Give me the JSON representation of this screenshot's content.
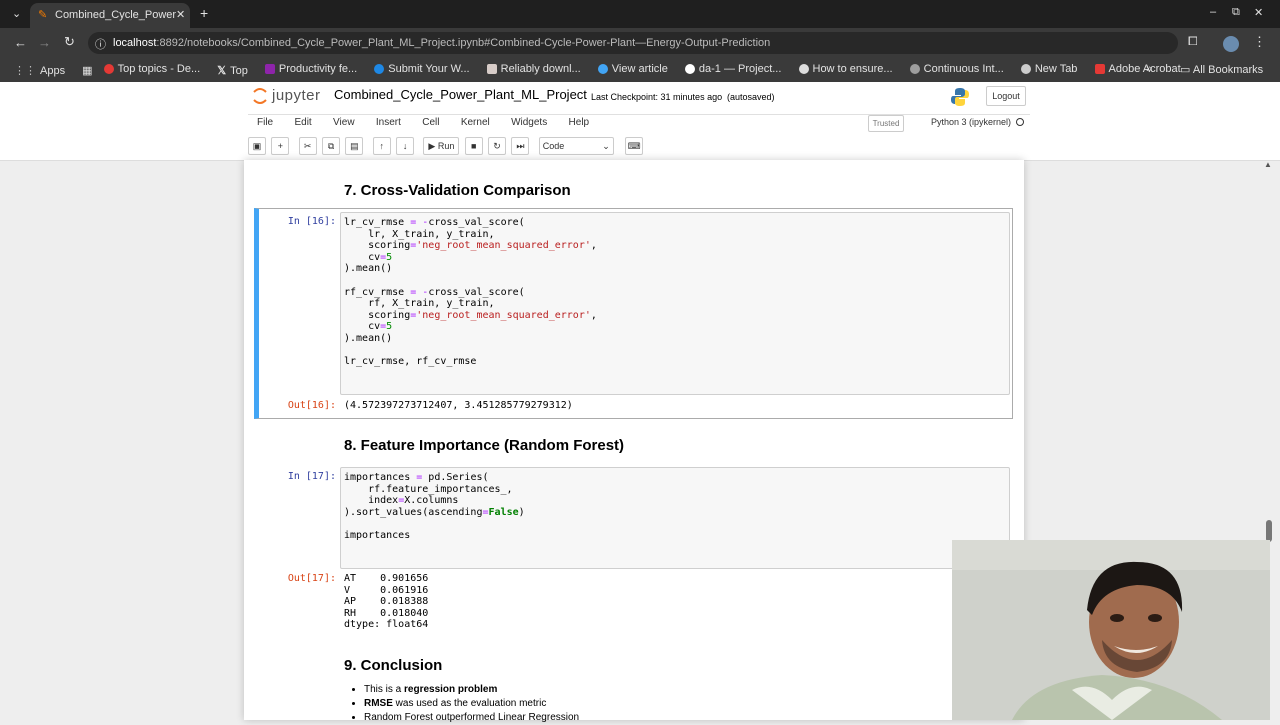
{
  "browser": {
    "tab_title": "Combined_Cycle_Power",
    "url_host": "localhost",
    "url_rest": ":8892/notebooks/Combined_Cycle_Power_Plant_ML_Project.ipynb#Combined-Cycle-Power-Plant—Energy-Output-Prediction",
    "bookmarks": [
      "Apps",
      "Top topics - De...",
      "Top",
      "Productivity fe...",
      "Submit Your W...",
      "Reliably downl...",
      "View article",
      "da-1 — Project...",
      "How to ensure...",
      "Continuous Int...",
      "New Tab",
      "Adobe Acrobat"
    ],
    "all_bookmarks": "All Bookmarks"
  },
  "jupyter": {
    "logo": "jupyter",
    "notebook_name": "Combined_Cycle_Power_Plant_ML_Project",
    "checkpoint": "Last Checkpoint: 31 minutes ago",
    "autosave": "(autosaved)",
    "logout": "Logout",
    "menus": [
      "File",
      "Edit",
      "View",
      "Insert",
      "Cell",
      "Kernel",
      "Widgets",
      "Help"
    ],
    "trusted": "Trusted",
    "kernel": "Python 3 (ipykernel)",
    "run_label": "Run",
    "cell_type": "Code"
  },
  "cells": {
    "h7": "7. Cross-Validation Comparison",
    "in16": "In [16]:",
    "out16_prompt": "Out[16]:",
    "out16": "(4.572397273712407, 3.451285779279312)",
    "h8": "8. Feature Importance (Random Forest)",
    "in17": "In [17]:",
    "out17_prompt": "Out[17]:",
    "out17": "AT    0.901656\nV     0.061916\nAP    0.018388\nRH    0.018040\ndtype: float64",
    "h9": "9. Conclusion",
    "concl1_pre": "This is a ",
    "concl1_bold": "regression problem",
    "concl2_bold": "RMSE",
    "concl2_post": " was used as the evaluation metric",
    "concl3": "Random Forest outperformed Linear Regression"
  }
}
